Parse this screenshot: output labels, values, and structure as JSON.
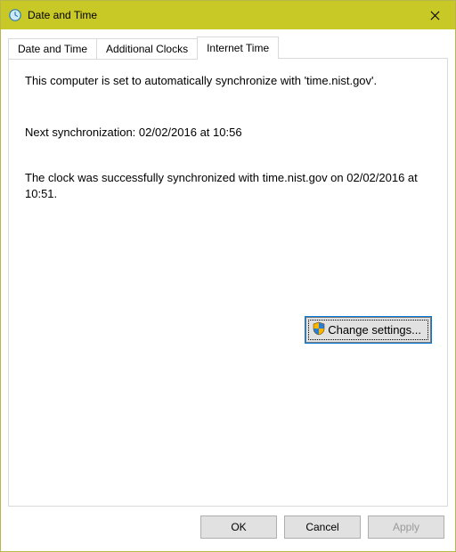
{
  "window": {
    "title": "Date and Time"
  },
  "tabs": {
    "t0": "Date and Time",
    "t1": "Additional Clocks",
    "t2": "Internet Time"
  },
  "content": {
    "sync_auto": "This computer is set to automatically synchronize with 'time.nist.gov'.",
    "next_sync": "Next synchronization: 02/02/2016 at 10:56",
    "last_status": "The clock was successfully synchronized with time.nist.gov on 02/02/2016 at 10:51.",
    "change_settings": "Change settings..."
  },
  "buttons": {
    "ok": "OK",
    "cancel": "Cancel",
    "apply": "Apply"
  }
}
